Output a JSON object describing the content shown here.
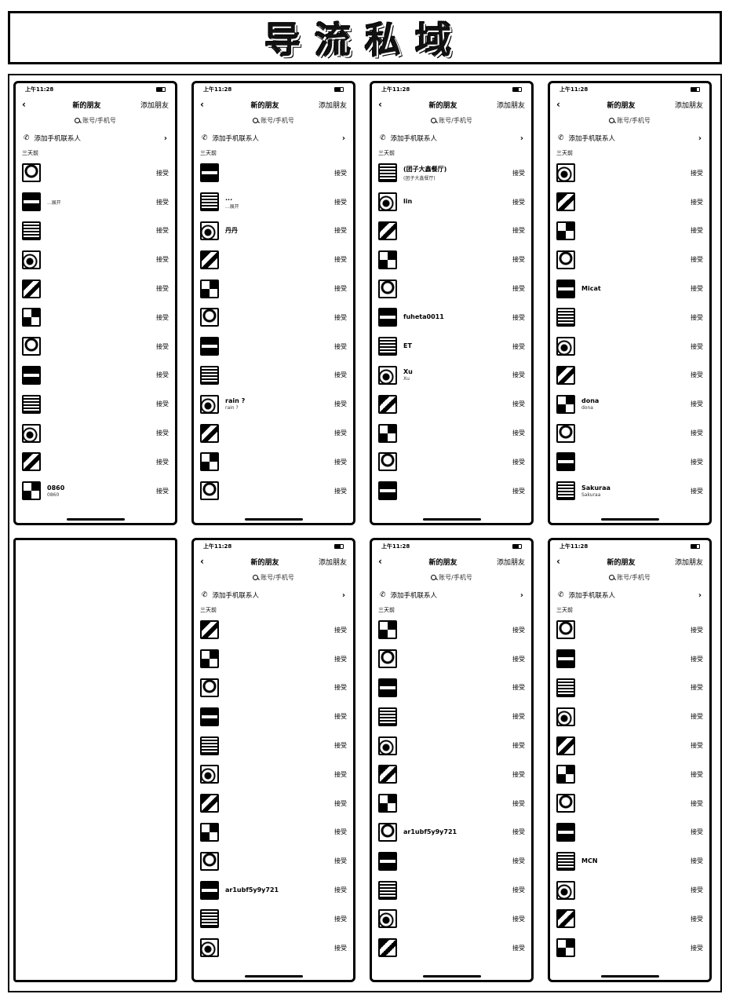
{
  "title": "导流私域",
  "screen_common": {
    "status_time": "上午11:28",
    "back": "‹",
    "nav_title": "新的朋友",
    "nav_add": "添加朋友",
    "search_placeholder": "账号/手机号",
    "add_contacts": "添加手机联系人",
    "section_label": "三天前",
    "accept": "接受"
  },
  "screens": [
    {
      "requests": [
        {
          "name": "",
          "sub": ""
        },
        {
          "name": "",
          "sub": "...展开"
        },
        {
          "name": "",
          "sub": ""
        },
        {
          "name": "",
          "sub": ""
        },
        {
          "name": "",
          "sub": ""
        },
        {
          "name": "",
          "sub": ""
        },
        {
          "name": "",
          "sub": ""
        },
        {
          "name": "",
          "sub": ""
        },
        {
          "name": "",
          "sub": ""
        },
        {
          "name": "",
          "sub": ""
        },
        {
          "name": "",
          "sub": ""
        },
        {
          "name": "0860",
          "sub": "0860"
        }
      ]
    },
    {
      "requests": [
        {
          "name": "",
          "sub": ""
        },
        {
          "name": "...",
          "sub": "...展开"
        },
        {
          "name": "丹丹",
          "sub": ""
        },
        {
          "name": "",
          "sub": ""
        },
        {
          "name": "",
          "sub": ""
        },
        {
          "name": "",
          "sub": ""
        },
        {
          "name": "",
          "sub": ""
        },
        {
          "name": "",
          "sub": ""
        },
        {
          "name": "rain ? ",
          "sub": "rain ? "
        },
        {
          "name": "",
          "sub": ""
        },
        {
          "name": "",
          "sub": ""
        },
        {
          "name": "",
          "sub": ""
        }
      ]
    },
    {
      "requests": [
        {
          "name": "(团子大鑫餐厅)",
          "sub": "(团子大鑫餐厅)"
        },
        {
          "name": "lin",
          "sub": ""
        },
        {
          "name": "",
          "sub": ""
        },
        {
          "name": "",
          "sub": ""
        },
        {
          "name": "",
          "sub": ""
        },
        {
          "name": "fuheta0011",
          "sub": ""
        },
        {
          "name": "ET",
          "sub": ""
        },
        {
          "name": "Xu",
          "sub": "Xu"
        },
        {
          "name": "",
          "sub": ""
        },
        {
          "name": "",
          "sub": ""
        },
        {
          "name": "",
          "sub": ""
        },
        {
          "name": "",
          "sub": ""
        }
      ]
    },
    {
      "requests": [
        {
          "name": "",
          "sub": ""
        },
        {
          "name": "",
          "sub": ""
        },
        {
          "name": "",
          "sub": ""
        },
        {
          "name": "",
          "sub": ""
        },
        {
          "name": "Micat",
          "sub": ""
        },
        {
          "name": "",
          "sub": ""
        },
        {
          "name": "",
          "sub": ""
        },
        {
          "name": "",
          "sub": ""
        },
        {
          "name": "dona",
          "sub": "dona"
        },
        {
          "name": "",
          "sub": ""
        },
        {
          "name": "",
          "sub": ""
        },
        {
          "name": "Sakuraa",
          "sub": "Sakuraa"
        }
      ]
    },
    {
      "requests": [
        {
          "name": "",
          "sub": ""
        },
        {
          "name": "",
          "sub": ""
        },
        {
          "name": "",
          "sub": ""
        },
        {
          "name": "",
          "sub": ""
        },
        {
          "name": "",
          "sub": ""
        },
        {
          "name": "",
          "sub": ""
        },
        {
          "name": "",
          "sub": ""
        },
        {
          "name": "",
          "sub": ""
        },
        {
          "name": "",
          "sub": ""
        },
        {
          "name": "ar1ubf5y9y721",
          "sub": ""
        },
        {
          "name": "",
          "sub": ""
        },
        {
          "name": "",
          "sub": ""
        }
      ]
    },
    {
      "requests": [
        {
          "name": "",
          "sub": ""
        },
        {
          "name": "",
          "sub": ""
        },
        {
          "name": "",
          "sub": ""
        },
        {
          "name": "",
          "sub": ""
        },
        {
          "name": "",
          "sub": ""
        },
        {
          "name": "",
          "sub": ""
        },
        {
          "name": "",
          "sub": ""
        },
        {
          "name": "ar1ubf5y9y721",
          "sub": ""
        },
        {
          "name": "",
          "sub": ""
        },
        {
          "name": "",
          "sub": ""
        },
        {
          "name": "",
          "sub": ""
        },
        {
          "name": "",
          "sub": ""
        }
      ]
    },
    {
      "requests": [
        {
          "name": "",
          "sub": ""
        },
        {
          "name": "",
          "sub": ""
        },
        {
          "name": "",
          "sub": ""
        },
        {
          "name": "",
          "sub": ""
        },
        {
          "name": "",
          "sub": ""
        },
        {
          "name": "",
          "sub": ""
        },
        {
          "name": "",
          "sub": ""
        },
        {
          "name": "",
          "sub": ""
        },
        {
          "name": "MCN",
          "sub": ""
        },
        {
          "name": "",
          "sub": ""
        },
        {
          "name": "",
          "sub": ""
        },
        {
          "name": "",
          "sub": ""
        }
      ]
    }
  ]
}
